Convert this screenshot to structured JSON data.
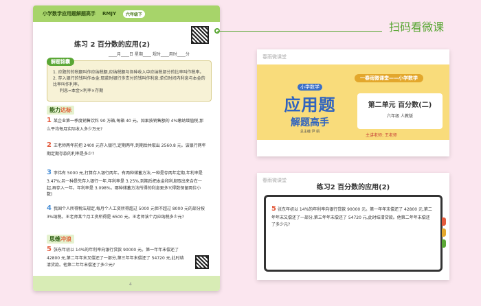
{
  "workbook": {
    "header": "小学数学应用题解题高手",
    "edition": "RMJY",
    "grade": "六年级下",
    "lesson_title": "练习 2   百分数的应用(2)",
    "date_line": "____月____日  星期____  规时____用时____分",
    "tip_tag": "解题锦囊",
    "tips": [
      "1. 应题的的税额叫作应纳税额,应纳税额与各种收入中应纳税部分的比率叫作税率。",
      "2. 存入银行的钱叫作本金;取款时银行多支付的钱叫作利息;单位时间内利息与本金的比率叫作利率。",
      "利息=本金×利率×存期"
    ],
    "section_ability": "能力",
    "section_ability_sub": "达标",
    "section_thinking": "思维",
    "section_thinking_sub": "冲浪",
    "questions": [
      {
        "num": "1",
        "text": "某企业第一季度销售饮料 90 万箱,每箱 40 元。如果按销售额的 4%缴纳增值税,那么平均每月实际收入多少万元?"
      },
      {
        "num": "2",
        "text": "王老师两年前把 2400 元存入银行,定期两年,到期后共取出 2560.8 元。该银行两年期定期存款的利率是多少?"
      },
      {
        "num": "3",
        "text": "李伟有 5000 元,打算存入银行两年。有两种储蓄方法,一种是存两年定期,年利率是 3.47%;另一种是先存入银行一年,年利率是 3.25%,到期后把本金和利息取出来合在一起,再存入一年。年利率是 3.098%。哪种储蓄方法所得的利息更多?(得数保留两位小数)"
      },
      {
        "num": "4",
        "text": "我国个人所得税法规定,每月个人工资所得超过 5000 元但不超过 8000 元的部分按 3%纳税。王老师某个月工资所得是 6500 元。王老师该个月应纳税多少元?"
      },
      {
        "num": "5",
        "text": "张东年初以 14%的年利率向银行贷款 90000 元。第一年年末偿还了 42800 元,第二年年末又偿还了一部分,第三年年末偿还了 54720 元,此时结清贷款。他第二年年末偿还了多少元?"
      }
    ],
    "page_num": "4"
  },
  "scan_label": "扫码看微课",
  "card1": {
    "logo": "春雨微课堂",
    "series": "一春雨微课堂——小学数学",
    "small": "小学数学",
    "title_big": "应用题",
    "title_sub": "解题高手",
    "author": "总主编  尹 娟",
    "unit": "第二单元  百分数(二)",
    "grade": "六年级 人教版",
    "teacher": "主讲老师: 王老师"
  },
  "card2": {
    "logo": "春雨微课堂",
    "title": "练习2    百分数的应用(2)",
    "q_num": "5",
    "q_text": "张东年初以 14%的年利率向银行贷款 90000 元。第一年年末偿还了 42800 元,第二年年末又偿还了一部分,第三年年末偿还了 54720 元,此时结清贷款。他第二年年末偿还了多少元?"
  }
}
